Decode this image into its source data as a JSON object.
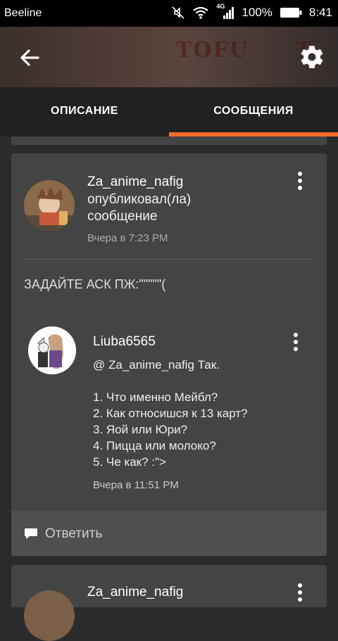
{
  "status_bar": {
    "carrier": "Beeline",
    "network": "4G",
    "battery": "100%",
    "time": "8:41"
  },
  "header": {
    "banner_text_1": "TOFU",
    "banner_text_2": "T"
  },
  "tabs": [
    {
      "label": "ОПИСАНИЕ",
      "active": false
    },
    {
      "label": "СООБЩЕНИЯ",
      "active": true
    }
  ],
  "post": {
    "author": "Za_anime_nafig",
    "action_line1": "опубликовал(ла)",
    "action_line2": "сообщение",
    "time": "Вчера в 7:23 PM",
    "title": "ЗАДАЙТЕ АСК ПЖ:\"\"\"\"\"("
  },
  "reply": {
    "author": "Liuba6565",
    "lines": [
      "@ Za_anime_nafig  Так.",
      "",
      "1. Что именно Мейбл?",
      "2. Как относишся к 13 карт?",
      "3. Яой или Юри?",
      "4. Пицца или молоко?",
      "5. Че как? :\">"
    ],
    "time": "Вчера в 11:51 PM"
  },
  "footer": {
    "reply_label": "Ответить"
  },
  "next_post": {
    "author": "Za_anime_nafig"
  },
  "colors": {
    "accent": "#f26b2a",
    "card": "#444444",
    "background": "#2b2b2b",
    "tabbar": "#212121"
  },
  "icons": [
    "back-arrow-icon",
    "gear-icon",
    "more-vertical-icon",
    "comment-icon",
    "wifi-icon",
    "signal-icon",
    "battery-icon",
    "mute-icon"
  ]
}
